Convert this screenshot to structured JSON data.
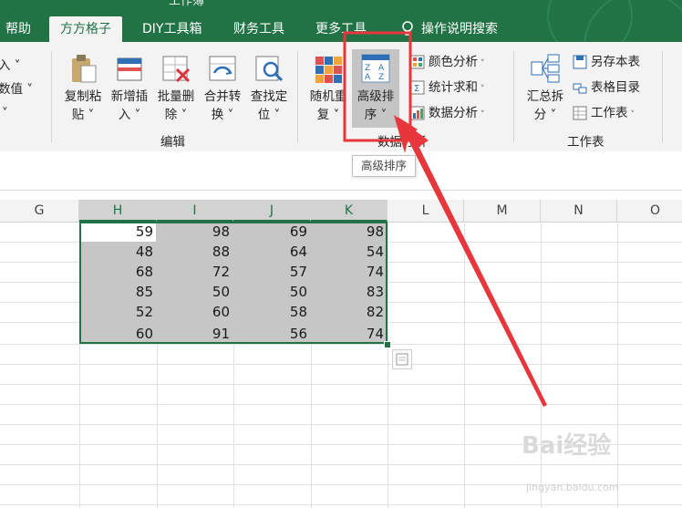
{
  "tabs": [
    {
      "label": "帮助",
      "active": false
    },
    {
      "label": "方方格子",
      "active": true
    },
    {
      "label": "DIY工具箱",
      "active": false
    },
    {
      "label": "财务工具",
      "active": false
    },
    {
      "label": "更多工具",
      "active": false
    }
  ],
  "search": {
    "label": "操作说明搜索",
    "icon": "lightbulb-icon"
  },
  "window_title_fragment": "工作簿",
  "ribbon": {
    "left_partial": {
      "item1": "入 ˅",
      "item2": "数值 ˅",
      "item3": "˅"
    },
    "edit_group": {
      "label": "编辑",
      "buttons": [
        {
          "line1": "复制粘",
          "line2": "贴 ˅",
          "icon": "paste-icon"
        },
        {
          "line1": "新增插",
          "line2": "入 ˅",
          "icon": "insert-row-icon"
        },
        {
          "line1": "批量删",
          "line2": "除 ˅",
          "icon": "delete-icon"
        },
        {
          "line1": "合并转",
          "line2": "换 ˅",
          "icon": "merge-convert-icon"
        },
        {
          "line1": "查找定",
          "line2": "位 ˅",
          "icon": "find-locate-icon"
        }
      ]
    },
    "data_analysis_group": {
      "label": "数据分析",
      "buttons": [
        {
          "line1": "随机重",
          "line2": "复 ˅",
          "icon": "random-repeat-icon"
        },
        {
          "line1": "高级排",
          "line2": "序 ˅",
          "icon": "advanced-sort-icon",
          "highlighted": true
        }
      ],
      "small_buttons": [
        {
          "label": "颜色分析",
          "icon": "color-analysis-icon"
        },
        {
          "label": "统计求和",
          "icon": "sum-icon"
        },
        {
          "label": "数据分析",
          "icon": "data-analysis-icon"
        }
      ]
    },
    "worksheet_group": {
      "label": "工作表",
      "buttons": [
        {
          "line1": "汇总拆",
          "line2": "分 ˅",
          "icon": "summary-split-icon"
        }
      ],
      "small_buttons": [
        {
          "label": "另存本表",
          "icon": "save-sheet-icon"
        },
        {
          "label": "表格目录",
          "icon": "sheet-directory-icon"
        },
        {
          "label": "工作表",
          "icon": "worksheet-icon"
        }
      ]
    }
  },
  "tooltip": {
    "text": "高级排序"
  },
  "grid": {
    "columns": [
      "G",
      "H",
      "I",
      "J",
      "K",
      "L",
      "M",
      "N",
      "O"
    ],
    "selected_columns": [
      "H",
      "I",
      "J",
      "K"
    ],
    "rows": [
      [
        "59",
        "98",
        "69",
        "98"
      ],
      [
        "48",
        "88",
        "64",
        "54"
      ],
      [
        "68",
        "72",
        "57",
        "74"
      ],
      [
        "85",
        "50",
        "50",
        "83"
      ],
      [
        "52",
        "60",
        "58",
        "82"
      ],
      [
        "60",
        "91",
        "56",
        "74"
      ]
    ]
  },
  "colors": {
    "ribbon_green": "#217346",
    "highlight_red": "#e8373c",
    "selection_gray": "#c6c6c6"
  },
  "watermark": {
    "text": "Bai经验",
    "sub": "jingyan.baidu.com"
  }
}
